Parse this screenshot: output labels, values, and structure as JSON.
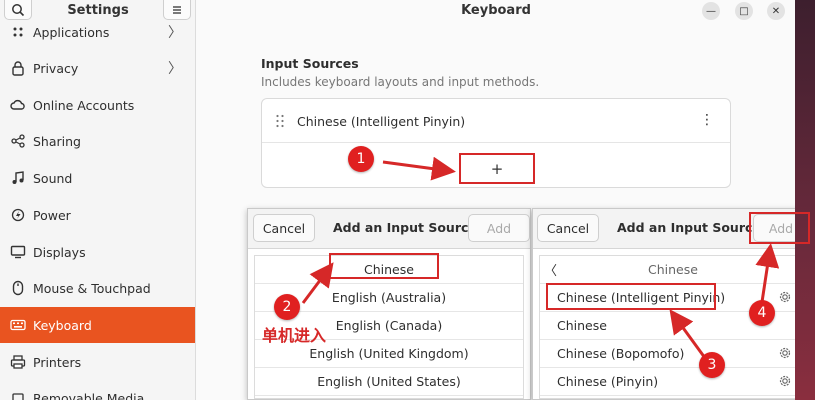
{
  "sidebar": {
    "title": "Settings",
    "items": [
      {
        "label": "Applications",
        "icon": "applications-icon",
        "chevron": true
      },
      {
        "label": "Privacy",
        "icon": "privacy-lock-icon",
        "chevron": true
      },
      {
        "label": "Online Accounts",
        "icon": "cloud-icon",
        "chevron": false
      },
      {
        "label": "Sharing",
        "icon": "share-icon",
        "chevron": false
      },
      {
        "label": "Sound",
        "icon": "music-note-icon",
        "chevron": false
      },
      {
        "label": "Power",
        "icon": "power-icon",
        "chevron": false
      },
      {
        "label": "Displays",
        "icon": "display-icon",
        "chevron": false
      },
      {
        "label": "Mouse & Touchpad",
        "icon": "mouse-icon",
        "chevron": false
      },
      {
        "label": "Keyboard",
        "icon": "keyboard-icon",
        "chevron": false,
        "active": true
      },
      {
        "label": "Printers",
        "icon": "printer-icon",
        "chevron": false
      },
      {
        "label": "Removable Media",
        "icon": "removable-media-icon",
        "chevron": false
      }
    ]
  },
  "window": {
    "title": "Keyboard"
  },
  "input_sources": {
    "title": "Input Sources",
    "subtitle": "Includes keyboard layouts and input methods.",
    "sources": [
      "Chinese (Intelligent Pinyin)"
    ],
    "add_label": "+"
  },
  "dialog_left": {
    "cancel_label": "Cancel",
    "title": "Add an Input Source",
    "add_label": "Add",
    "items": [
      "Chinese",
      "English (Australia)",
      "English (Canada)",
      "English (United Kingdom)",
      "English (United States)"
    ]
  },
  "dialog_right": {
    "cancel_label": "Cancel",
    "title": "Add an Input Source",
    "add_label": "Add",
    "back_glyph": "〈",
    "category": "Chinese",
    "items": [
      {
        "label": "Chinese (Intelligent Pinyin)",
        "gear": true
      },
      {
        "label": "Chinese",
        "gear": false
      },
      {
        "label": "Chinese (Bopomofo)",
        "gear": true
      },
      {
        "label": "Chinese (Pinyin)",
        "gear": true
      }
    ]
  },
  "annotations": {
    "markers": [
      "1",
      "2",
      "3",
      "4"
    ],
    "step2_note": "单机进入",
    "color": "#d62828"
  },
  "colors": {
    "accent": "#e95420",
    "annotation_red": "#d62828"
  }
}
